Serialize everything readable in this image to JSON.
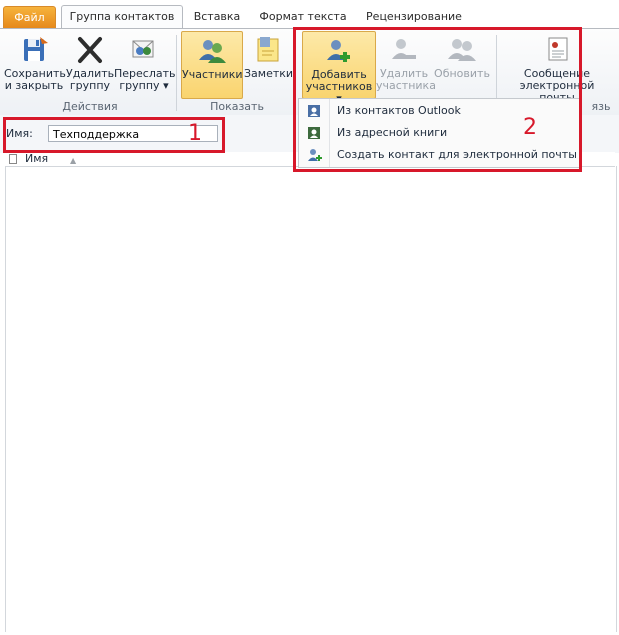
{
  "tabs": {
    "file": "Файл",
    "contact_group": "Группа контактов",
    "insert": "Вставка",
    "format_text": "Формат текста",
    "review": "Рецензирование"
  },
  "ribbon": {
    "save_close": [
      "Сохранить",
      "и закрыть"
    ],
    "delete_group": [
      "Удалить",
      "группу"
    ],
    "forward_group": [
      "Переслать",
      "группу ▾"
    ],
    "members": "Участники",
    "notes": "Заметки",
    "add_members": [
      "Добавить",
      "участников ▾"
    ],
    "remove_member": [
      "Удалить",
      "участника"
    ],
    "update": "Обновить",
    "email_message": [
      "Сообщение",
      "электронной почты"
    ],
    "group_actions": "Действия",
    "group_show": "Показать",
    "group_partial": "язь"
  },
  "name_field": {
    "label": "Имя:",
    "value": "Техподдержка"
  },
  "list": {
    "column_name": "Имя"
  },
  "add_members_menu": [
    "Из контактов Outlook",
    "Из адресной книги",
    "Создать контакт для электронной почты"
  ],
  "annotations": [
    "1",
    "2"
  ],
  "colors": {
    "highlight": "#d7182a",
    "file_tab": "#e6891b"
  }
}
